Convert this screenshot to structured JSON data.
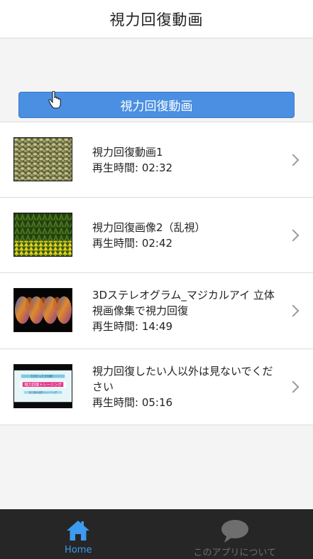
{
  "header": {
    "title": "視力回復動画"
  },
  "banner": {
    "label": "視力回復動画"
  },
  "videos": [
    {
      "title": "視力回復動画1",
      "duration": "再生時間: 02:32",
      "thumb": "pebbles"
    },
    {
      "title": "視力回復画像2（乱視）",
      "duration": "再生時間: 02:42",
      "thumb": "green-yellow"
    },
    {
      "title": "3Dステレオグラム_マジカルアイ 立体視画像集で視力回復",
      "duration": "再生時間: 14:49",
      "thumb": "twist"
    },
    {
      "title": "視力回復したい人以外は見ないでください",
      "duration": "再生時間: 05:16",
      "thumb": "banner"
    }
  ],
  "tabs": {
    "home": {
      "label": "Home",
      "icon": "home-icon",
      "color": "#3d9bf0"
    },
    "about": {
      "label": "このアプリについて",
      "icon": "chat-bubble-icon",
      "color": "#6e6e6e"
    }
  },
  "thumb_banner_text": {
    "top": "1日たった3分間！",
    "main": "視力回復トレーニング",
    "sub": "目と脳の活性トレーニング"
  }
}
